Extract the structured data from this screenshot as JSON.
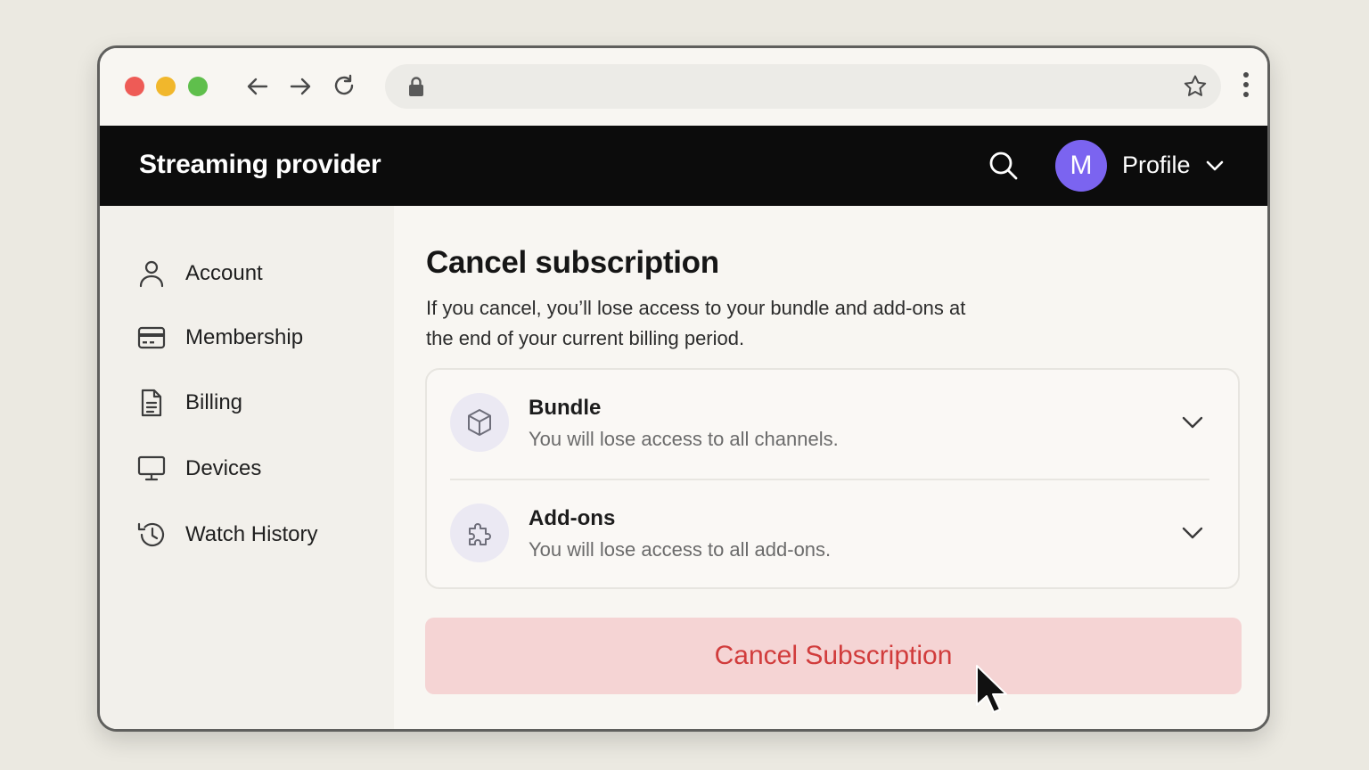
{
  "app": {
    "brand": "Streaming provider",
    "profile_label": "Profile",
    "avatar_initial": "M"
  },
  "sidebar": {
    "items": [
      {
        "label": "Account",
        "icon": "user-icon"
      },
      {
        "label": "Membership",
        "icon": "credit-card-icon"
      },
      {
        "label": "Billing",
        "icon": "document-icon"
      },
      {
        "label": "Devices",
        "icon": "monitor-icon"
      },
      {
        "label": "Watch History",
        "icon": "history-icon"
      }
    ]
  },
  "main": {
    "title": "Cancel subscription",
    "description": "If you cancel, you’ll lose access to your bundle and add-ons at the end of your current billing period.",
    "items": [
      {
        "title": "Bundle",
        "subtitle": "You will lose access to all channels.",
        "icon": "box-icon"
      },
      {
        "title": "Add-ons",
        "subtitle": "You will lose access to all add-ons.",
        "icon": "puzzle-icon"
      }
    ],
    "cancel_button": "Cancel Subscription"
  },
  "colors": {
    "header_bg": "#0c0c0c",
    "avatar": "#7b64f0",
    "danger_text": "#d13c3c",
    "danger_bg": "#f5d4d4"
  }
}
